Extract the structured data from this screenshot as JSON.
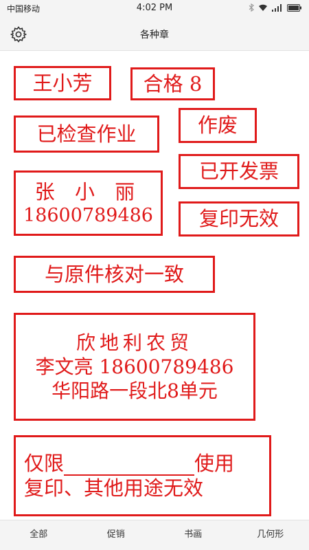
{
  "status_bar": {
    "carrier": "中国移动",
    "time": "4:02 PM",
    "battery_icon": "battery-icon",
    "wifi_icon": "wifi-icon",
    "signal_icon": "signal-icon",
    "bluetooth_icon": "bluetooth-icon"
  },
  "header": {
    "title": "各种章",
    "settings_icon": "gear-icon"
  },
  "stamp_color": "#e01a1a",
  "stamps": {
    "name": {
      "text": "王小芳"
    },
    "qualified": {
      "text": "合格 8"
    },
    "homework_checked": {
      "text": "已检查作业"
    },
    "void": {
      "text": "作废"
    },
    "invoiced": {
      "text": "已开发票"
    },
    "contact": {
      "name": "张 小 丽",
      "phone": "18600789486"
    },
    "copy_invalid": {
      "text": "复印无效"
    },
    "matches_original": {
      "text": "与原件核对一致"
    },
    "company": {
      "company": "欣地利农贸",
      "contact": "李文亮 18600789486",
      "address": "华阳路一段北8单元"
    },
    "restricted_use": {
      "line1_prefix": "仅限",
      "line1_suffix": "使用",
      "line2": "复印、其他用途无效"
    }
  },
  "bottom_nav": {
    "tabs": [
      "全部",
      "促销",
      "书画",
      "几何形"
    ]
  }
}
